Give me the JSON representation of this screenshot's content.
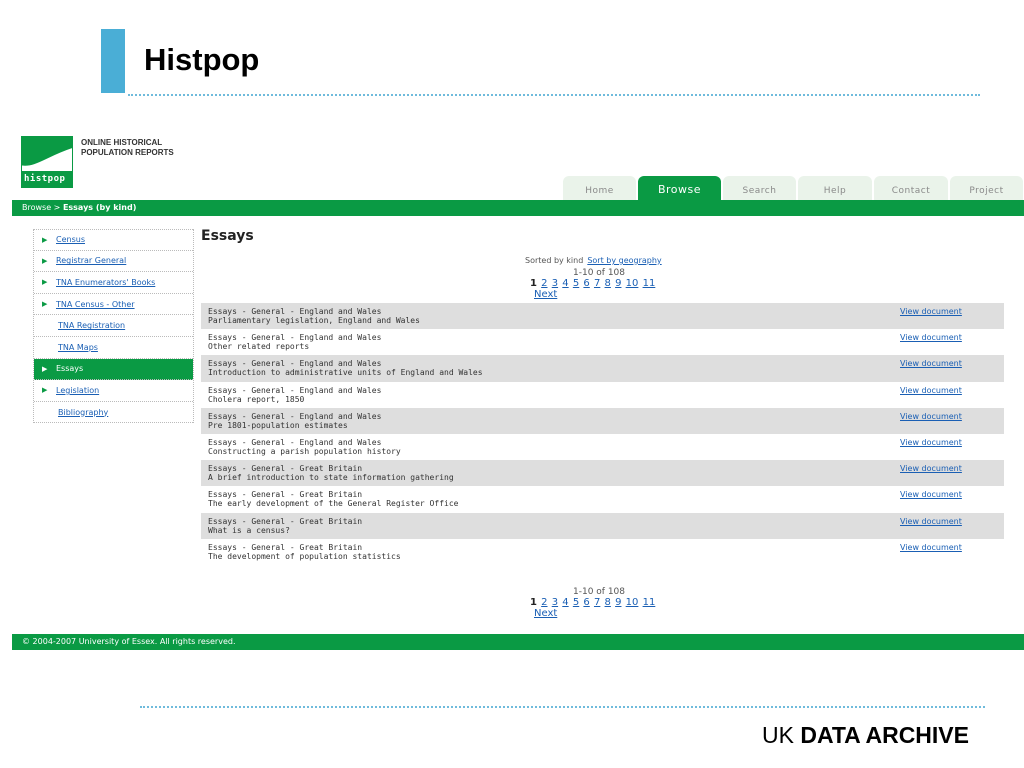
{
  "slide": {
    "title": "Histpop",
    "archive_prefix": "UK",
    "archive_bold": "DATA ARCHIVE"
  },
  "site": {
    "logo_word": "histpop",
    "logo_line1": "ONLINE HISTORICAL",
    "logo_line2": "POPULATION REPORTS"
  },
  "tabs": [
    {
      "label": "Home",
      "active": false
    },
    {
      "label": "Browse",
      "active": true
    },
    {
      "label": "Search",
      "active": false
    },
    {
      "label": "Help",
      "active": false
    },
    {
      "label": "Contact",
      "active": false
    },
    {
      "label": "Project",
      "active": false
    }
  ],
  "breadcrumb": {
    "root": "Browse",
    "separator": " > ",
    "current": "Essays (by kind)"
  },
  "sidebar": {
    "items": [
      {
        "label": "Census",
        "arrow": true
      },
      {
        "label": "Registrar General",
        "arrow": true
      },
      {
        "label": "TNA Enumerators' Books",
        "arrow": true
      },
      {
        "label": "TNA Census - Other",
        "arrow": true
      },
      {
        "label": "TNA Registration",
        "arrow": false
      },
      {
        "label": "TNA Maps",
        "arrow": false
      },
      {
        "label": "Essays",
        "arrow": true,
        "active": true
      },
      {
        "label": "Legislation",
        "arrow": true
      },
      {
        "label": "Bibliography",
        "arrow": false
      }
    ]
  },
  "main": {
    "title": "Essays",
    "sorted_by": "Sorted by kind",
    "sort_alt": "Sort by geography",
    "count": "1-10 of 108",
    "current_page": "1",
    "pages": [
      "2",
      "3",
      "4",
      "5",
      "6",
      "7",
      "8",
      "9",
      "10",
      "11"
    ],
    "next": "Next",
    "view_label": "View document",
    "results": [
      {
        "line1": "Essays - General - England and Wales",
        "line2": "Parliamentary legislation, England and Wales"
      },
      {
        "line1": "Essays - General - England and Wales",
        "line2": "Other related reports"
      },
      {
        "line1": "Essays - General - England and Wales",
        "line2": "Introduction to administrative units of England and Wales"
      },
      {
        "line1": "Essays - General - England and Wales",
        "line2": "Cholera report, 1850"
      },
      {
        "line1": "Essays - General - England and Wales",
        "line2": "Pre 1801-population estimates"
      },
      {
        "line1": "Essays - General - England and Wales",
        "line2": "Constructing a parish population history"
      },
      {
        "line1": "Essays - General - Great Britain",
        "line2": "A brief introduction to state information gathering"
      },
      {
        "line1": "Essays - General - Great Britain",
        "line2": "The early development of the General Register Office"
      },
      {
        "line1": "Essays - General - Great Britain",
        "line2": "What is a census?"
      },
      {
        "line1": "Essays - General - Great Britain",
        "line2": "The development of population statistics"
      }
    ]
  },
  "footer": {
    "copyright": "© 2004-2007  University of Essex. All rights reserved."
  },
  "colors": {
    "green": "#0a9a44",
    "accent_blue": "#4aaed6",
    "link": "#1a5fb4"
  }
}
